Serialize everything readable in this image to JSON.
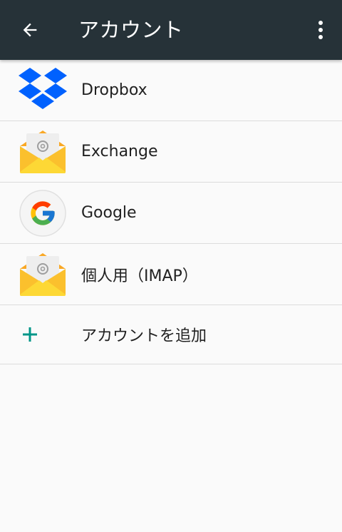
{
  "appbar": {
    "title": "アカウント",
    "back_icon": "arrow-left-icon",
    "menu_icon": "more-vert-icon"
  },
  "accounts": [
    {
      "label": "Dropbox",
      "icon": "dropbox-icon"
    },
    {
      "label": "Exchange",
      "icon": "email-envelope-icon"
    },
    {
      "label": "Google",
      "icon": "google-icon"
    },
    {
      "label": "個人用（IMAP）",
      "icon": "email-envelope-icon"
    }
  ],
  "add_account": {
    "label": "アカウントを追加",
    "icon": "plus-icon"
  },
  "colors": {
    "appbar": "#263238",
    "background": "#fafafa",
    "accent": "#009688",
    "dropbox": "#0061fe",
    "envelope": "#fbc02d"
  }
}
